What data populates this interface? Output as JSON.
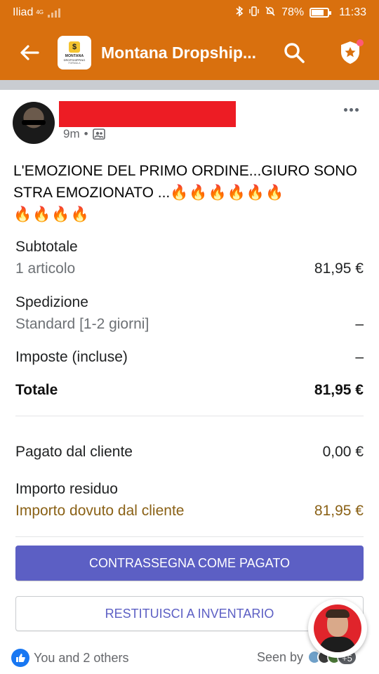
{
  "status_bar": {
    "carrier": "Iliad",
    "network": "4G",
    "battery": "78%",
    "battery_level": 0.78,
    "time": "11:33"
  },
  "app_bar": {
    "title": "Montana Dropship...",
    "logo_lines": [
      "MONTANA",
      "DROPSHIPPING",
      "FORMULA"
    ],
    "logo_mark": "$"
  },
  "post": {
    "time": "9m",
    "separator": "•",
    "text": "L'EMOZIONE DEL PRIMO ORDINE...GIURO SONO STRA EMOZIONATO ...",
    "fires_inline": "🔥🔥🔥🔥🔥🔥",
    "fires_next": "🔥🔥🔥🔥"
  },
  "order": {
    "subtotal_label": "Subtotale",
    "subtotal_items": "1 articolo",
    "subtotal_value": "81,95 €",
    "shipping_label": "Spedizione",
    "shipping_method": "Standard [1-2 giorni]",
    "shipping_value": "–",
    "taxes_label": "Imposte (incluse)",
    "taxes_value": "–",
    "total_label": "Totale",
    "total_value": "81,95 €",
    "paid_label": "Pagato dal cliente",
    "paid_value": "0,00 €",
    "balance_label": "Importo residuo",
    "due_label": "Importo dovuto dal cliente",
    "due_value": "81,95 €"
  },
  "buttons": {
    "mark_paid": "CONTRASSEGNA COME PAGATO",
    "restock": "RESTITUISCI A INVENTARIO"
  },
  "footer": {
    "reactions": "You and 2 others",
    "seen_by": "Seen by",
    "seen_more": "+5"
  },
  "colors": {
    "brand_orange": "#d9700e",
    "primary_button": "#5c5fc4",
    "due_text": "#8a6116",
    "redaction": "#ed1c24"
  }
}
